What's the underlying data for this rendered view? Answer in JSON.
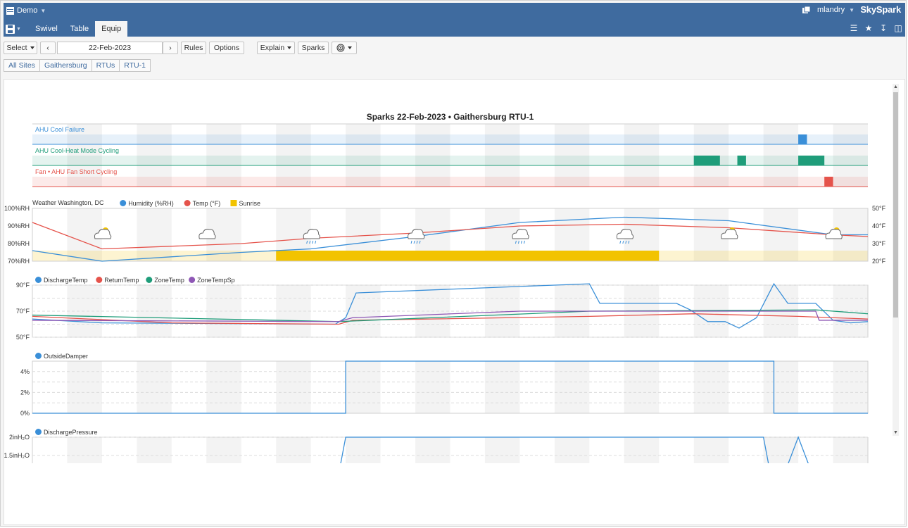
{
  "app": {
    "menu_label": "Demo",
    "user": "mlandry",
    "brand": "SkySpark"
  },
  "tabs": [
    {
      "label": "Swivel",
      "active": false
    },
    {
      "label": "Table",
      "active": false
    },
    {
      "label": "Equip",
      "active": true
    }
  ],
  "toolbar": {
    "select_label": "Select",
    "date": "22-Feb-2023",
    "rules_label": "Rules",
    "options_label": "Options",
    "explain_label": "Explain",
    "sparks_label": "Sparks"
  },
  "breadcrumbs": [
    "All Sites",
    "Gaithersburg",
    "RTUs",
    "RTU-1"
  ],
  "colors": {
    "header": "#3f6b9f",
    "blue": "#3a8fd8",
    "red": "#e5534b",
    "green": "#1f9d7a",
    "purple": "#8e57b5",
    "sunrise": "#f2c300"
  },
  "chart_data": [
    {
      "type": "gantt",
      "title": "Sparks 22-Feb-2023 • Gaithersburg RTU-1",
      "x_range": [
        "00:00",
        "24:00"
      ],
      "rows": [
        {
          "name": "AHU Cool Failure",
          "color": "#3a8fd8",
          "spans": [
            [
              "22:00",
              "22:15"
            ]
          ]
        },
        {
          "name": "AHU Cool-Heat Mode Cycling",
          "color": "#1f9d7a",
          "spans": [
            [
              "19:00",
              "19:45"
            ],
            [
              "20:15",
              "20:30"
            ],
            [
              "22:00",
              "22:45"
            ]
          ]
        },
        {
          "name": "Fan • AHU Fan Short Cycling",
          "color": "#e5534b",
          "spans": [
            [
              "22:45",
              "23:00"
            ]
          ]
        }
      ]
    },
    {
      "type": "line",
      "title": "Weather Washington, DC",
      "legend": [
        "Humidity (%RH)",
        "Temp (°F)",
        "Sunrise"
      ],
      "y_left": {
        "ticks": [
          "70%RH",
          "80%RH",
          "90%RH",
          "100%RH"
        ],
        "range": [
          70,
          100
        ]
      },
      "y_right": {
        "ticks": [
          "20°F",
          "30°F",
          "40°F",
          "50°F"
        ],
        "range": [
          20,
          50
        ]
      },
      "x_hours": [
        0,
        2,
        6,
        8,
        11,
        14,
        17,
        20,
        23,
        24
      ],
      "series": [
        {
          "name": "Humidity (%RH)",
          "color": "#3a8fd8",
          "unit": "%RH",
          "values": [
            76,
            70,
            75,
            77,
            84,
            92,
            95,
            93,
            85,
            85
          ]
        },
        {
          "name": "Temp (°F)",
          "color": "#e5534b",
          "unit": "°F",
          "values": [
            42,
            27,
            30,
            33,
            36,
            40,
            41,
            39,
            35,
            34
          ]
        }
      ],
      "bands": [
        {
          "name": "Sunrise",
          "color": "#f2c300",
          "from_hour": 7,
          "to_hour": 18
        }
      ],
      "weather": [
        {
          "hour": 2,
          "icon": "partly-cloudy-icon"
        },
        {
          "hour": 5,
          "icon": "cloud-icon"
        },
        {
          "hour": 8,
          "icon": "rain-icon"
        },
        {
          "hour": 11,
          "icon": "rain-icon"
        },
        {
          "hour": 14,
          "icon": "rain-icon"
        },
        {
          "hour": 17,
          "icon": "rain-icon"
        },
        {
          "hour": 20,
          "icon": "partly-cloudy-icon"
        },
        {
          "hour": 23,
          "icon": "partly-cloudy-icon"
        }
      ]
    },
    {
      "type": "line",
      "legend": [
        "DischargeTemp",
        "ReturnTemp",
        "ZoneTemp",
        "ZoneTempSp"
      ],
      "y": {
        "ticks": [
          "50°F",
          "70°F",
          "90°F"
        ],
        "range": [
          50,
          90
        ]
      },
      "series": [
        {
          "name": "DischargeTemp",
          "color": "#3a8fd8",
          "unit": "°F",
          "points": [
            [
              0,
              64
            ],
            [
              2,
              61
            ],
            [
              8.7,
              60
            ],
            [
              9.0,
              65
            ],
            [
              9.3,
              84
            ],
            [
              14,
              89
            ],
            [
              16,
              91
            ],
            [
              16.3,
              76
            ],
            [
              18.5,
              76
            ],
            [
              18.9,
              71
            ],
            [
              19.4,
              62
            ],
            [
              19.9,
              62
            ],
            [
              20.3,
              57
            ],
            [
              20.8,
              65
            ],
            [
              21.3,
              91
            ],
            [
              21.7,
              76
            ],
            [
              22.5,
              76
            ],
            [
              23.0,
              63
            ],
            [
              23.5,
              61
            ],
            [
              24,
              62
            ]
          ]
        },
        {
          "name": "ReturnTemp",
          "color": "#e5534b",
          "unit": "°F",
          "points": [
            [
              0,
              66
            ],
            [
              4,
              61
            ],
            [
              8.8,
              60
            ],
            [
              9.2,
              63
            ],
            [
              16,
              66
            ],
            [
              19,
              68
            ],
            [
              22,
              66
            ],
            [
              24,
              64
            ]
          ]
        },
        {
          "name": "ZoneTemp",
          "color": "#1f9d7a",
          "unit": "°F",
          "points": [
            [
              0,
              67
            ],
            [
              8.8,
              62
            ],
            [
              16,
              70
            ],
            [
              22.5,
              71
            ],
            [
              24,
              68
            ]
          ]
        },
        {
          "name": "ZoneTempSp",
          "color": "#8e57b5",
          "unit": "°F",
          "points": [
            [
              0,
              63
            ],
            [
              8.8,
              62
            ],
            [
              9.2,
              65
            ],
            [
              14,
              70
            ],
            [
              22.5,
              70
            ],
            [
              22.6,
              63
            ],
            [
              24,
              63
            ]
          ]
        }
      ]
    },
    {
      "type": "line",
      "legend": [
        "OutsideDamper"
      ],
      "y": {
        "ticks": [
          "0%",
          "2%",
          "4%"
        ],
        "range": [
          0,
          5
        ]
      },
      "series": [
        {
          "name": "OutsideDamper",
          "color": "#3a8fd8",
          "unit": "%",
          "points": [
            [
              0,
              0
            ],
            [
              9.0,
              0
            ],
            [
              9.0,
              5
            ],
            [
              21.3,
              5
            ],
            [
              21.3,
              0
            ],
            [
              24,
              0
            ]
          ]
        }
      ]
    },
    {
      "type": "line",
      "legend": [
        "DischargePressure"
      ],
      "y": {
        "ticks": [
          "1.5inH₂O",
          "2inH₂O"
        ],
        "range": [
          1.0,
          2.0
        ]
      },
      "series": [
        {
          "name": "DischargePressure",
          "color": "#3a8fd8",
          "unit": "inH₂O",
          "points": [
            [
              8.8,
              1.0
            ],
            [
              9.0,
              2.0
            ],
            [
              21.0,
              2.0
            ],
            [
              21.2,
              1.0
            ],
            [
              21.6,
              1.0
            ],
            [
              22.0,
              2.0
            ],
            [
              22.4,
              1.0
            ]
          ]
        }
      ]
    }
  ]
}
